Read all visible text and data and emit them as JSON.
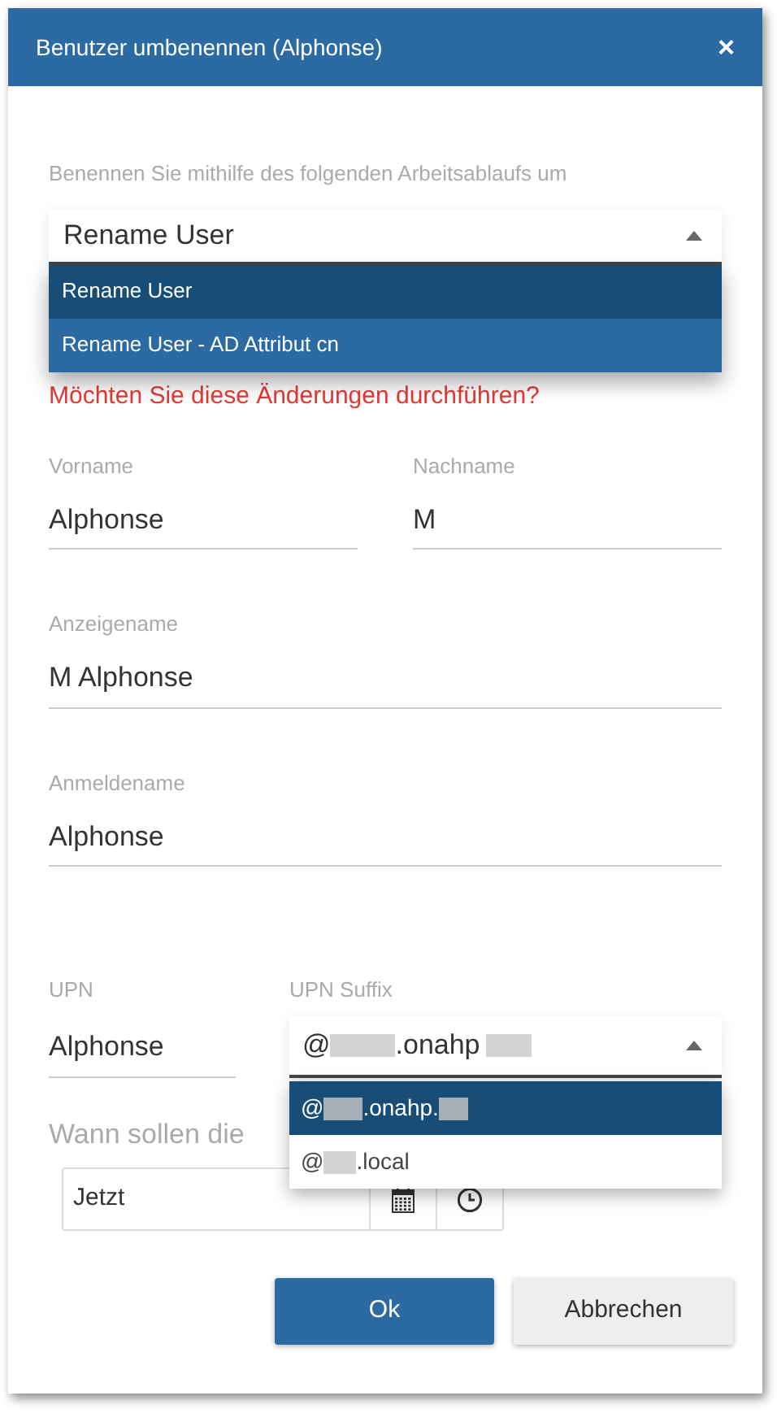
{
  "dialog": {
    "title": "Benutzer umbenennen (Alphonse)",
    "close": "×"
  },
  "workflow": {
    "label": "Benennen Sie mithilfe des folgenden Arbeitsablaufs um",
    "value": "Rename User",
    "expanded": true,
    "options": [
      {
        "label": "Rename User",
        "selected": true
      },
      {
        "label": "Rename User - AD Attribut cn",
        "selected": false
      }
    ]
  },
  "warning": [
    "Möchten Sie diese Änderungen durchführen?"
  ],
  "fields": [
    {
      "label": "Vorname",
      "value": "Alphonse"
    },
    {
      "label": "Nachname",
      "value": "M"
    }
  ],
  "display_name": {
    "label": "Anzeigename",
    "value": "M Alphonse"
  },
  "logon_name": {
    "label": "Anmeldename",
    "value": "Alphonse"
  },
  "upn": {
    "label": "UPN",
    "value": "Alphonse"
  },
  "upn_suffix": {
    "label": "UPN Suffix",
    "value_prefix": "@",
    "value_suffix": ".onahp",
    "expanded": true,
    "options": [
      {
        "prefix": "@",
        "suffix": ".onahp.",
        "selected": true
      },
      {
        "prefix": "@",
        "suffix": ".local",
        "selected": false
      }
    ]
  },
  "schedule": {
    "label": "Wann sollen die",
    "value": "Jetzt"
  },
  "buttons": [
    {
      "label": "Ok",
      "kind": "primary"
    },
    {
      "label": "Abbrechen",
      "kind": "secondary"
    }
  ]
}
